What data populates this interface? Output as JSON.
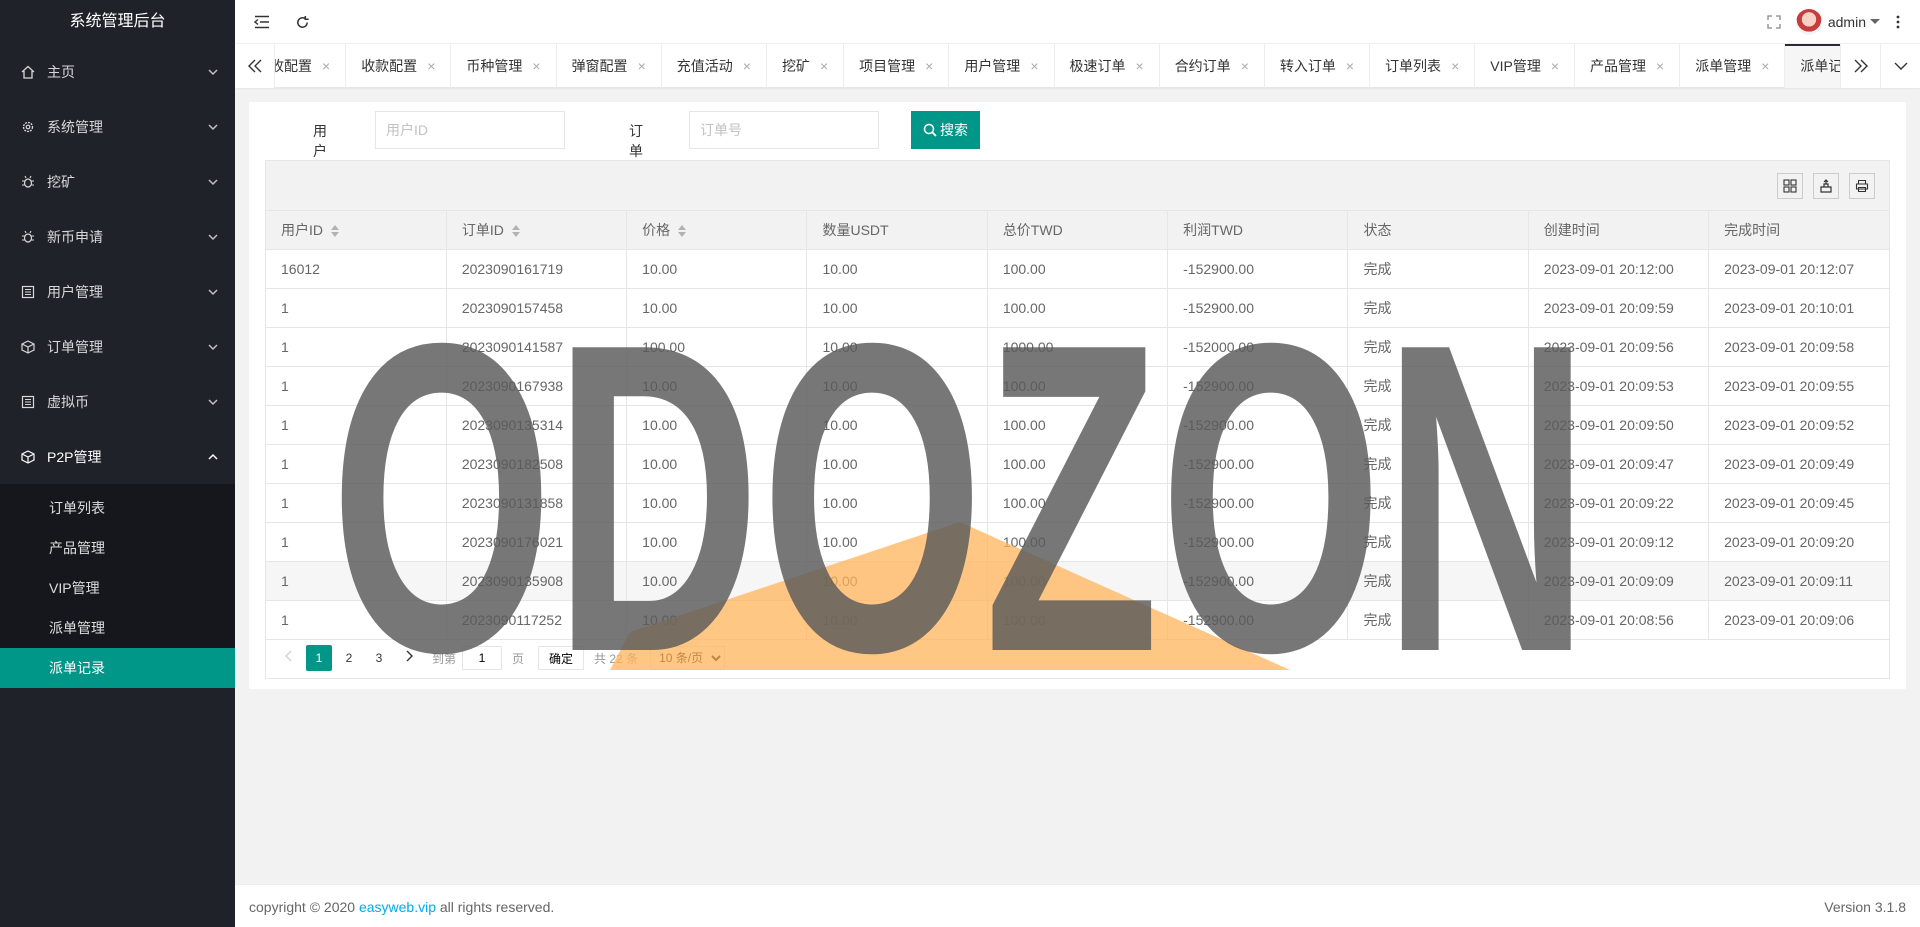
{
  "app": {
    "title": "系统管理后台"
  },
  "sidebar": {
    "items": [
      {
        "label": "主页",
        "icon": "home-icon"
      },
      {
        "label": "系统管理",
        "icon": "gear-icon"
      },
      {
        "label": "挖矿",
        "icon": "bug-icon"
      },
      {
        "label": "新币申请",
        "icon": "bug-icon"
      },
      {
        "label": "用户管理",
        "icon": "list-icon"
      },
      {
        "label": "订单管理",
        "icon": "cube-icon"
      },
      {
        "label": "虚拟币",
        "icon": "list-icon"
      },
      {
        "label": "P2P管理",
        "icon": "cube-icon"
      }
    ],
    "submenu": [
      "订单列表",
      "产品管理",
      "VIP管理",
      "派单管理",
      "派单记录"
    ],
    "active_sub": "派单记录"
  },
  "header": {
    "username": "admin"
  },
  "tabs": [
    "收配置",
    "收款配置",
    "币种管理",
    "弹窗配置",
    "充值活动",
    "挖矿",
    "项目管理",
    "用户管理",
    "极速订单",
    "合约订单",
    "转入订单",
    "订单列表",
    "VIP管理",
    "产品管理",
    "派单管理",
    "派单记录"
  ],
  "active_tab": "派单记录",
  "search": {
    "user_id_label": "用户ID:",
    "user_id_placeholder": "用户ID",
    "order_no_label": "订单号:",
    "order_no_placeholder": "订单号",
    "button_label": "搜索"
  },
  "table": {
    "columns": [
      "用户ID",
      "订单ID",
      "价格",
      "数量USDT",
      "总价TWD",
      "利润TWD",
      "状态",
      "创建时间",
      "完成时间"
    ],
    "rows": [
      [
        "16012",
        "2023090161719",
        "10.00",
        "10.00",
        "100.00",
        "-152900.00",
        "完成",
        "2023-09-01 20:12:00",
        "2023-09-01 20:12:07"
      ],
      [
        "1",
        "2023090157458",
        "10.00",
        "10.00",
        "100.00",
        "-152900.00",
        "完成",
        "2023-09-01 20:09:59",
        "2023-09-01 20:10:01"
      ],
      [
        "1",
        "2023090141587",
        "100.00",
        "10.00",
        "1000.00",
        "-152000.00",
        "完成",
        "2023-09-01 20:09:56",
        "2023-09-01 20:09:58"
      ],
      [
        "1",
        "2023090167938",
        "10.00",
        "10.00",
        "100.00",
        "-152900.00",
        "完成",
        "2023-09-01 20:09:53",
        "2023-09-01 20:09:55"
      ],
      [
        "1",
        "2023090135314",
        "10.00",
        "10.00",
        "100.00",
        "-152900.00",
        "完成",
        "2023-09-01 20:09:50",
        "2023-09-01 20:09:52"
      ],
      [
        "1",
        "2023090182508",
        "10.00",
        "10.00",
        "100.00",
        "-152900.00",
        "完成",
        "2023-09-01 20:09:47",
        "2023-09-01 20:09:49"
      ],
      [
        "1",
        "2023090131858",
        "10.00",
        "10.00",
        "100.00",
        "-152900.00",
        "完成",
        "2023-09-01 20:09:22",
        "2023-09-01 20:09:45"
      ],
      [
        "1",
        "2023090176021",
        "10.00",
        "10.00",
        "100.00",
        "-152900.00",
        "完成",
        "2023-09-01 20:09:12",
        "2023-09-01 20:09:20"
      ],
      [
        "1",
        "2023090135908",
        "10.00",
        "10.00",
        "100.00",
        "-152900.00",
        "完成",
        "2023-09-01 20:09:09",
        "2023-09-01 20:09:11"
      ],
      [
        "1",
        "2023090117252",
        "10.00",
        "10.00",
        "100.00",
        "-152900.00",
        "完成",
        "2023-09-01 20:08:56",
        "2023-09-01 20:09:06"
      ]
    ]
  },
  "pager": {
    "pages": [
      "1",
      "2",
      "3"
    ],
    "goto_label": "到第",
    "goto_value": "1",
    "page_label": "页",
    "confirm_label": "确定",
    "total_label": "共 22 条",
    "size_option": "10 条/页"
  },
  "footer": {
    "copyright_prefix": "copyright © 2020 ",
    "link_text": "easyweb.vip",
    "copyright_suffix": " all rights reserved.",
    "version": "Version 3.1.8"
  },
  "watermark": {
    "text": "ODOZON"
  },
  "colors": {
    "primary": "#009688",
    "sidebar": "#20222a",
    "link": "#01aaed",
    "watermark": "#5a5a5a",
    "watermark_accent": "#ffb45a"
  }
}
